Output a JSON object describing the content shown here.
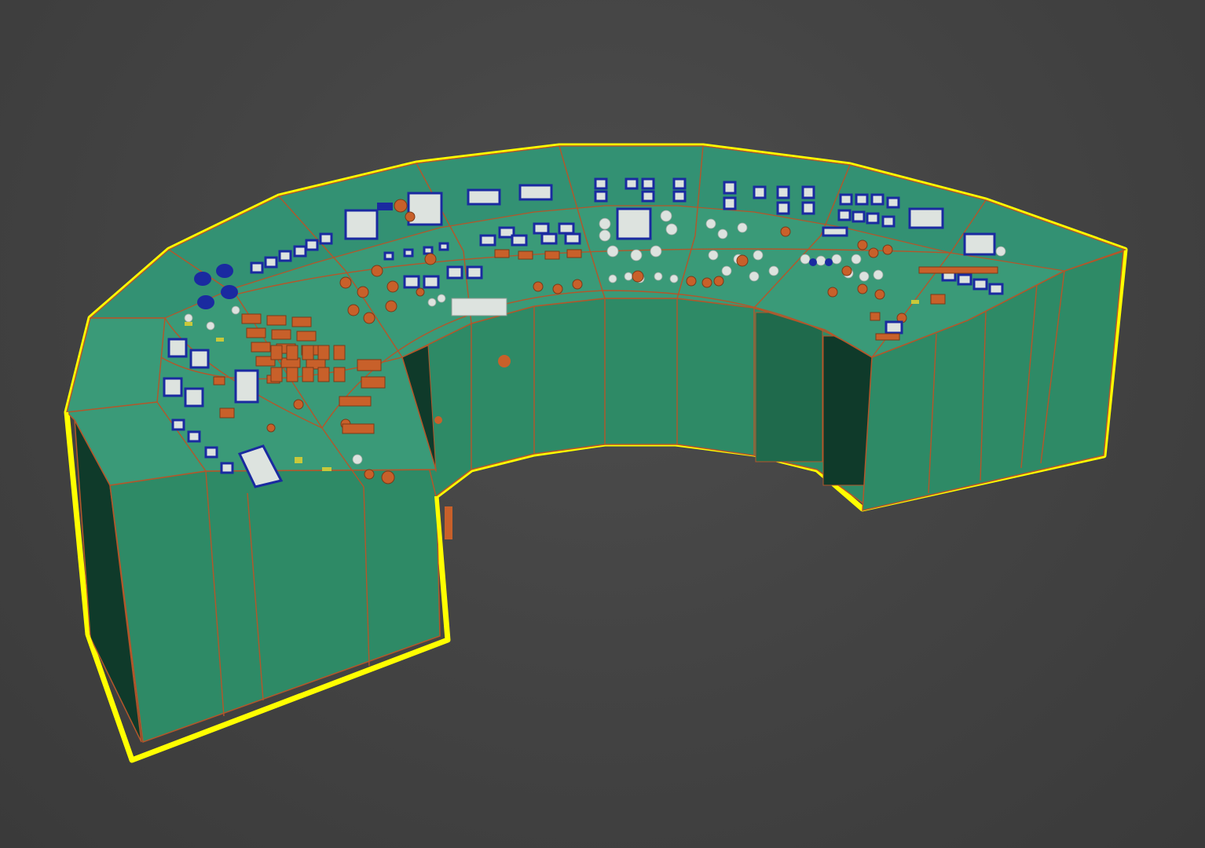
{
  "viewport": {
    "background_color": "#474747",
    "selection_color": "#ffff00"
  },
  "model": {
    "kind": "control-room-console",
    "shape": "curved horseshoe desk",
    "selected": true,
    "render_mode": "wireframe-on-shaded",
    "colors": {
      "body": "#2e8a66",
      "top_surface": "#3a9a78",
      "panel_face": "#339173",
      "dark_opening": "#0f3a2a",
      "edge_wire": "#b4562a",
      "control_orange": "#c8602a",
      "control_blue": "#1a2aa0",
      "control_white": "#dde3df",
      "control_yellow": "#c8c83a"
    },
    "segments": 11,
    "cabinet_doors": 8
  }
}
